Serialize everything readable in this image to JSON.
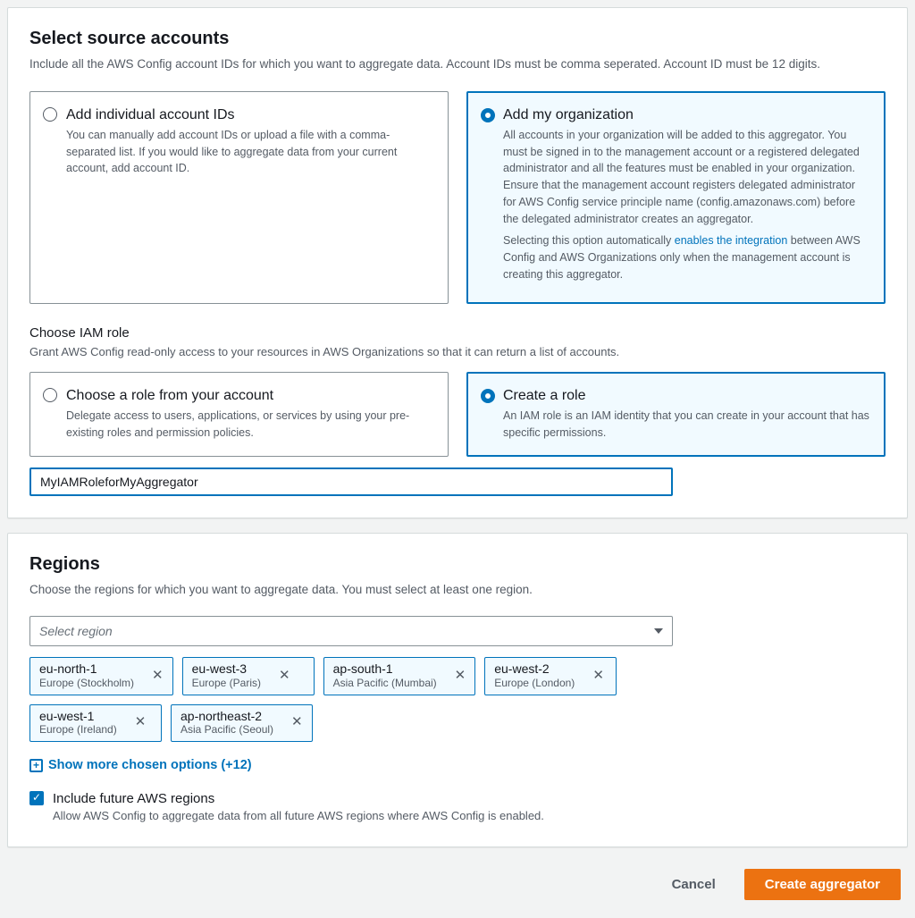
{
  "source": {
    "title": "Select source accounts",
    "desc": "Include all the AWS Config account IDs for which you want to aggregate data. Account IDs must be comma seperated. Account ID must be 12 digits.",
    "opt1": {
      "title": "Add individual account IDs",
      "desc": "You can manually add account IDs or upload a file with a comma-separated list. If you would like to aggregate data from your current account, add account ID."
    },
    "opt2": {
      "title": "Add my organization",
      "desc1": "All accounts in your organization will be added to this aggregator. You must be signed in to the management account or a registered delegated administrator and all the features must be enabled in your organization. Ensure that the management account registers delegated administrator for AWS Config service principle name (config.amazonaws.com) before the delegated administrator creates an aggregator.",
      "desc2a": "Selecting this option automatically ",
      "link": "enables the integration",
      "desc2b": " between AWS Config and AWS Organizations only when the management account is creating this aggregator."
    },
    "iamLabel": "Choose IAM role",
    "iamDesc": "Grant AWS Config read-only access to your resources in AWS Organizations so that it can return a list of accounts.",
    "iamOpt1": {
      "title": "Choose a role from your account",
      "desc": "Delegate access to users, applications, or services by using your pre-existing roles and permission policies."
    },
    "iamOpt2": {
      "title": "Create a role",
      "desc": "An IAM role is an IAM identity that you can create in your account that has specific permissions."
    },
    "roleName": "MyIAMRoleforMyAggregator"
  },
  "regions": {
    "title": "Regions",
    "desc": "Choose the regions for which you want to aggregate data. You must select at least one region.",
    "placeholder": "Select region",
    "tokens": [
      {
        "code": "eu-north-1",
        "name": "Europe (Stockholm)"
      },
      {
        "code": "eu-west-3",
        "name": "Europe (Paris)"
      },
      {
        "code": "ap-south-1",
        "name": "Asia Pacific (Mumbai)"
      },
      {
        "code": "eu-west-2",
        "name": "Europe (London)"
      },
      {
        "code": "eu-west-1",
        "name": "Europe (Ireland)"
      },
      {
        "code": "ap-northeast-2",
        "name": "Asia Pacific (Seoul)"
      }
    ],
    "showMore": "Show more chosen options (+12)",
    "includeFuture": {
      "title": "Include future AWS regions",
      "desc": "Allow AWS Config to aggregate data from all future AWS regions where AWS Config is enabled."
    }
  },
  "footer": {
    "cancel": "Cancel",
    "submit": "Create aggregator"
  }
}
